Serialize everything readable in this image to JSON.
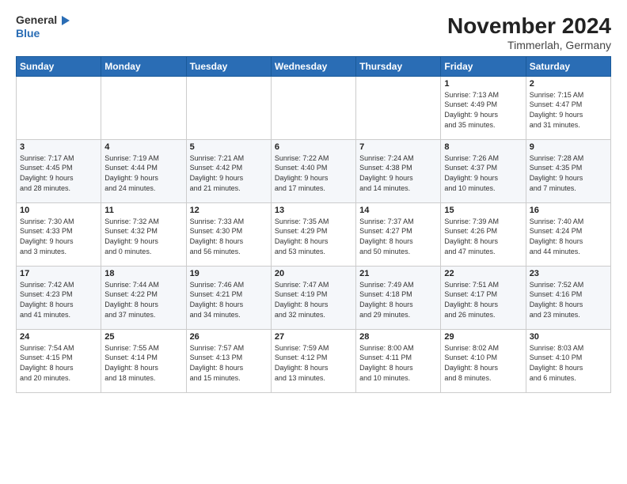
{
  "header": {
    "logo_general": "General",
    "logo_blue": "Blue",
    "title": "November 2024",
    "subtitle": "Timmerlah, Germany"
  },
  "weekdays": [
    "Sunday",
    "Monday",
    "Tuesday",
    "Wednesday",
    "Thursday",
    "Friday",
    "Saturday"
  ],
  "weeks": [
    [
      {
        "day": "",
        "info": ""
      },
      {
        "day": "",
        "info": ""
      },
      {
        "day": "",
        "info": ""
      },
      {
        "day": "",
        "info": ""
      },
      {
        "day": "",
        "info": ""
      },
      {
        "day": "1",
        "info": "Sunrise: 7:13 AM\nSunset: 4:49 PM\nDaylight: 9 hours\nand 35 minutes."
      },
      {
        "day": "2",
        "info": "Sunrise: 7:15 AM\nSunset: 4:47 PM\nDaylight: 9 hours\nand 31 minutes."
      }
    ],
    [
      {
        "day": "3",
        "info": "Sunrise: 7:17 AM\nSunset: 4:45 PM\nDaylight: 9 hours\nand 28 minutes."
      },
      {
        "day": "4",
        "info": "Sunrise: 7:19 AM\nSunset: 4:44 PM\nDaylight: 9 hours\nand 24 minutes."
      },
      {
        "day": "5",
        "info": "Sunrise: 7:21 AM\nSunset: 4:42 PM\nDaylight: 9 hours\nand 21 minutes."
      },
      {
        "day": "6",
        "info": "Sunrise: 7:22 AM\nSunset: 4:40 PM\nDaylight: 9 hours\nand 17 minutes."
      },
      {
        "day": "7",
        "info": "Sunrise: 7:24 AM\nSunset: 4:38 PM\nDaylight: 9 hours\nand 14 minutes."
      },
      {
        "day": "8",
        "info": "Sunrise: 7:26 AM\nSunset: 4:37 PM\nDaylight: 9 hours\nand 10 minutes."
      },
      {
        "day": "9",
        "info": "Sunrise: 7:28 AM\nSunset: 4:35 PM\nDaylight: 9 hours\nand 7 minutes."
      }
    ],
    [
      {
        "day": "10",
        "info": "Sunrise: 7:30 AM\nSunset: 4:33 PM\nDaylight: 9 hours\nand 3 minutes."
      },
      {
        "day": "11",
        "info": "Sunrise: 7:32 AM\nSunset: 4:32 PM\nDaylight: 9 hours\nand 0 minutes."
      },
      {
        "day": "12",
        "info": "Sunrise: 7:33 AM\nSunset: 4:30 PM\nDaylight: 8 hours\nand 56 minutes."
      },
      {
        "day": "13",
        "info": "Sunrise: 7:35 AM\nSunset: 4:29 PM\nDaylight: 8 hours\nand 53 minutes."
      },
      {
        "day": "14",
        "info": "Sunrise: 7:37 AM\nSunset: 4:27 PM\nDaylight: 8 hours\nand 50 minutes."
      },
      {
        "day": "15",
        "info": "Sunrise: 7:39 AM\nSunset: 4:26 PM\nDaylight: 8 hours\nand 47 minutes."
      },
      {
        "day": "16",
        "info": "Sunrise: 7:40 AM\nSunset: 4:24 PM\nDaylight: 8 hours\nand 44 minutes."
      }
    ],
    [
      {
        "day": "17",
        "info": "Sunrise: 7:42 AM\nSunset: 4:23 PM\nDaylight: 8 hours\nand 41 minutes."
      },
      {
        "day": "18",
        "info": "Sunrise: 7:44 AM\nSunset: 4:22 PM\nDaylight: 8 hours\nand 37 minutes."
      },
      {
        "day": "19",
        "info": "Sunrise: 7:46 AM\nSunset: 4:21 PM\nDaylight: 8 hours\nand 34 minutes."
      },
      {
        "day": "20",
        "info": "Sunrise: 7:47 AM\nSunset: 4:19 PM\nDaylight: 8 hours\nand 32 minutes."
      },
      {
        "day": "21",
        "info": "Sunrise: 7:49 AM\nSunset: 4:18 PM\nDaylight: 8 hours\nand 29 minutes."
      },
      {
        "day": "22",
        "info": "Sunrise: 7:51 AM\nSunset: 4:17 PM\nDaylight: 8 hours\nand 26 minutes."
      },
      {
        "day": "23",
        "info": "Sunrise: 7:52 AM\nSunset: 4:16 PM\nDaylight: 8 hours\nand 23 minutes."
      }
    ],
    [
      {
        "day": "24",
        "info": "Sunrise: 7:54 AM\nSunset: 4:15 PM\nDaylight: 8 hours\nand 20 minutes."
      },
      {
        "day": "25",
        "info": "Sunrise: 7:55 AM\nSunset: 4:14 PM\nDaylight: 8 hours\nand 18 minutes."
      },
      {
        "day": "26",
        "info": "Sunrise: 7:57 AM\nSunset: 4:13 PM\nDaylight: 8 hours\nand 15 minutes."
      },
      {
        "day": "27",
        "info": "Sunrise: 7:59 AM\nSunset: 4:12 PM\nDaylight: 8 hours\nand 13 minutes."
      },
      {
        "day": "28",
        "info": "Sunrise: 8:00 AM\nSunset: 4:11 PM\nDaylight: 8 hours\nand 10 minutes."
      },
      {
        "day": "29",
        "info": "Sunrise: 8:02 AM\nSunset: 4:10 PM\nDaylight: 8 hours\nand 8 minutes."
      },
      {
        "day": "30",
        "info": "Sunrise: 8:03 AM\nSunset: 4:10 PM\nDaylight: 8 hours\nand 6 minutes."
      }
    ]
  ],
  "colors": {
    "header_bg": "#2a6db5",
    "header_text": "#ffffff",
    "border": "#cccccc"
  }
}
